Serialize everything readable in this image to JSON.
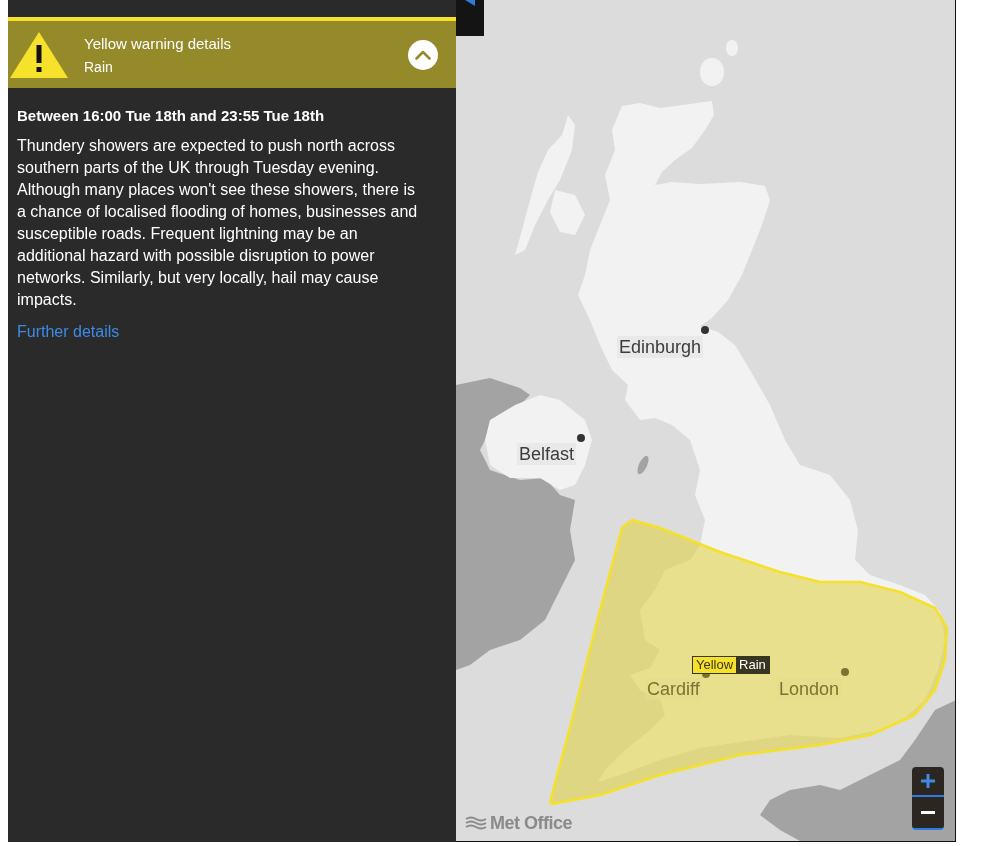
{
  "warning_panel": {
    "kind": "yellow",
    "title": "Yellow warning details",
    "hazard": "Rain",
    "expanded": true,
    "period": "Between 16:00 Tue 18th and 23:55 Tue 18th",
    "description": "Thundery showers are expected to push north across southern parts of the UK through Tuesday evening. Although many places won't see these showers, there is a chance of localised flooding of homes, businesses and susceptible roads. Frequent lightning may be an additional hazard with possible disruption to power networks. Similarly, but very locally, hail may cause impacts.",
    "link": "Further details"
  },
  "map": {
    "warning_area": {
      "kind": "yellow"
    },
    "warning_tag": {
      "kind": "yellow",
      "warning": "Yellow",
      "hazard": "Rain"
    },
    "cities": [
      {
        "name": "Edinburgh",
        "in_warning": false
      },
      {
        "name": "Belfast",
        "in_warning": false
      },
      {
        "name": "Cardiff",
        "in_warning": true
      },
      {
        "name": "London",
        "in_warning": true
      }
    ],
    "logo": "Met Office"
  }
}
